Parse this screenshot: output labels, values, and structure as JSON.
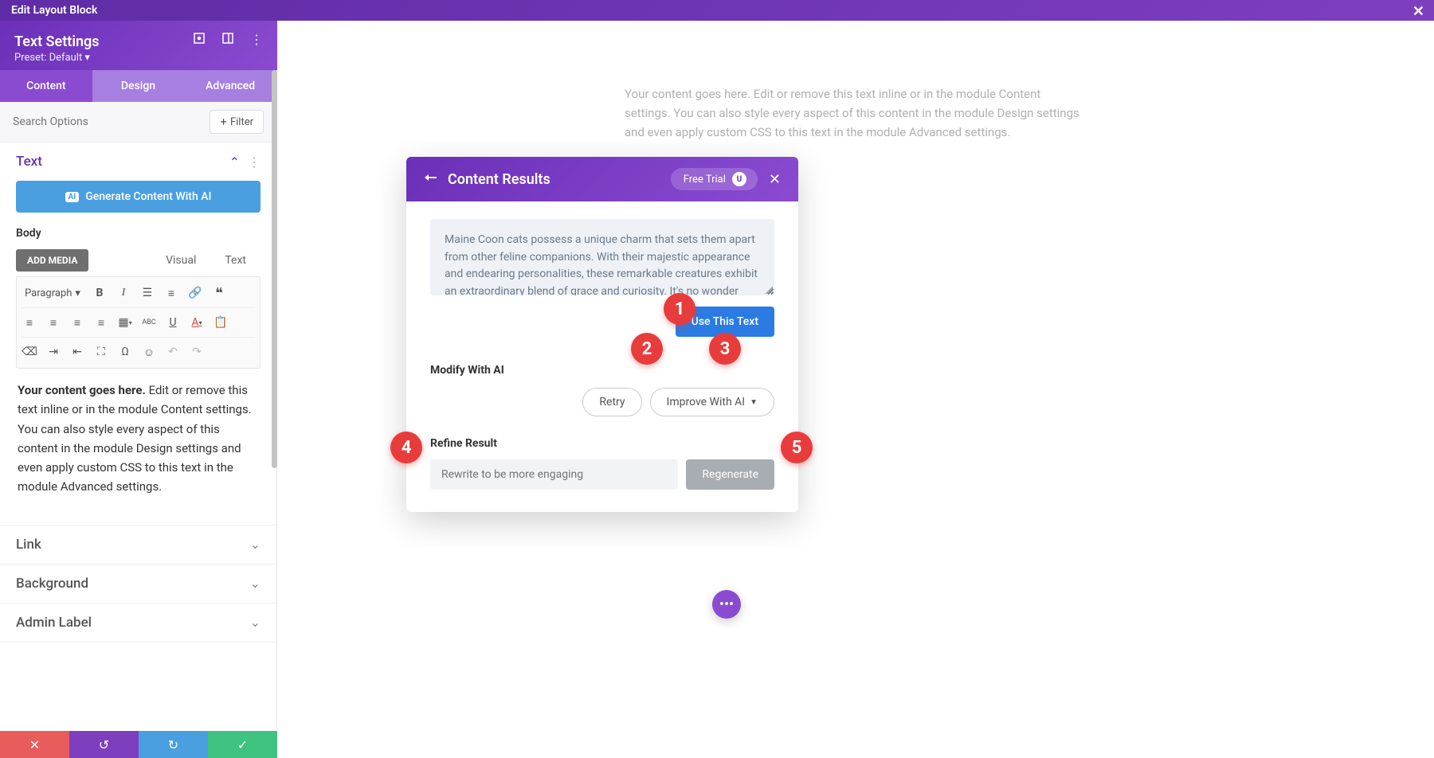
{
  "titlebar": {
    "text": "Edit Layout Block"
  },
  "header": {
    "title": "Text Settings",
    "preset": "Preset: Default ▾"
  },
  "tabs": {
    "content": "Content",
    "design": "Design",
    "advanced": "Advanced"
  },
  "search": {
    "placeholder": "Search Options",
    "filter": "Filter"
  },
  "section_text": {
    "title": "Text",
    "generate": "Generate Content With AI",
    "body_label": "Body",
    "add_media": "ADD MEDIA",
    "view_visual": "Visual",
    "view_text": "Text",
    "paragraph": "Paragraph",
    "editor_content_bold1": "Your content goes here.",
    "editor_content_rest": " Edit or remove this text inline or in the module Content settings. You can also style every aspect of this content in the module Design settings and even apply custom CSS to this text in the module Advanced settings."
  },
  "sections": {
    "link": "Link",
    "background": "Background",
    "admin_label": "Admin Label"
  },
  "canvas": {
    "text": "Your content goes here. Edit or remove this text inline or in the module Content settings. You can also style every aspect of this content in the module Design settings and even apply custom CSS to this text in the module Advanced settings."
  },
  "modal": {
    "title": "Content Results",
    "trial": "Free Trial",
    "trial_badge": "U",
    "result_text": "Maine Coon cats possess a unique charm that sets them apart from other feline companions. With their majestic appearance and endearing personalities, these remarkable creatures exhibit an extraordinary blend of grace and curiosity. It's no wonder why many describe them as having dog-like qualities. Maine Coons are known for their affectionate nature, often greeting their owners at the door and following them around the house",
    "use_this": "Use This Text",
    "modify_head": "Modify With AI",
    "retry": "Retry",
    "improve": "Improve With AI",
    "refine_head": "Refine Result",
    "refine_placeholder": "Rewrite to be more engaging",
    "regenerate": "Regenerate"
  },
  "badges": {
    "b1": "1",
    "b2": "2",
    "b3": "3",
    "b4": "4",
    "b5": "5"
  }
}
